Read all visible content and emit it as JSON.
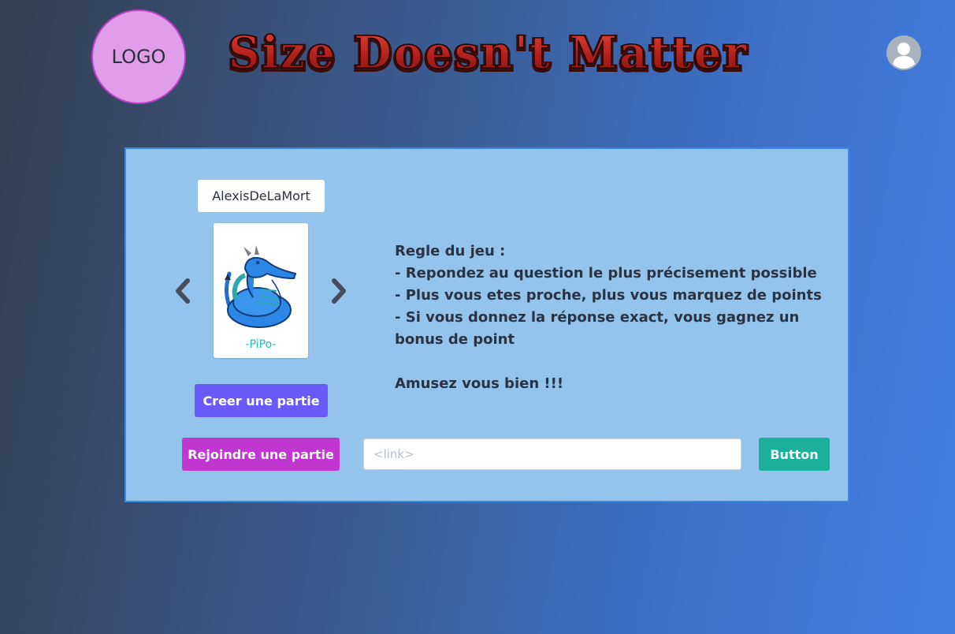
{
  "header": {
    "logo_text": "LOGO",
    "title": "Size Doesn't Matter",
    "avatar_icon": "user-avatar-icon"
  },
  "player": {
    "name": "AlexisDeLaMort",
    "character_signature": "-PiPo-",
    "prev_icon": "chevron-left-icon",
    "next_icon": "chevron-right-icon"
  },
  "rules": {
    "heading": "Regle du jeu :",
    "line1": "- Repondez au question le plus précisement possible",
    "line2": "- Plus vous etes proche, plus vous marquez de points",
    "line3a": "- Si vous donnez la réponse exact, vous gagnez un",
    "line3b": "bonus de point",
    "closing": "Amusez vous bien !!!"
  },
  "actions": {
    "create_label": "Creer une partie",
    "join_label": "Rejoindre une partie",
    "link_placeholder": "<link>",
    "link_value": "",
    "button_label": "Button"
  },
  "colors": {
    "card_bg": "#94c3ec",
    "create_btn": "#6a5af9",
    "join_btn": "#c036d0",
    "go_btn": "#1ab09c",
    "title_red": "#c22a22"
  }
}
